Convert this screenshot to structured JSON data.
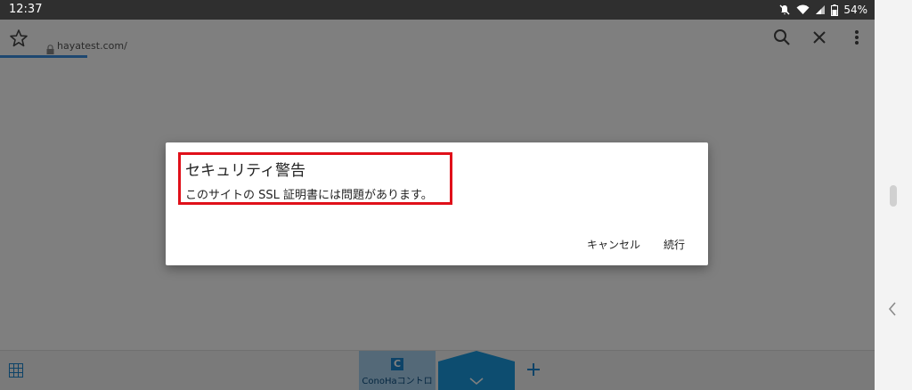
{
  "status_bar": {
    "time": "12:37",
    "battery": "54%",
    "icons": [
      "mute-icon",
      "wifi-icon",
      "signal-icon",
      "battery-icon"
    ]
  },
  "url_bar": {
    "url": "hayatest.com/",
    "icons": [
      "star-icon",
      "lock-icon",
      "search-icon",
      "close-icon",
      "more-vert-icon"
    ],
    "progress": 0.1
  },
  "dialog": {
    "title": "セキュリティ警告",
    "message": "このサイトの SSL 証明書には問題があります。",
    "cancel_label": "キャンセル",
    "continue_label": "続行",
    "highlight_color": "#e0101a"
  },
  "bottom_bar": {
    "tabs": [
      {
        "label": "ConoHaコントロ",
        "logo": "C"
      }
    ],
    "icons": [
      "grid-icon",
      "chevron-down-icon",
      "plus-icon"
    ],
    "accent": "#1a9ae0"
  },
  "side_panel": {
    "icons": [
      "chevron-left-icon"
    ]
  }
}
